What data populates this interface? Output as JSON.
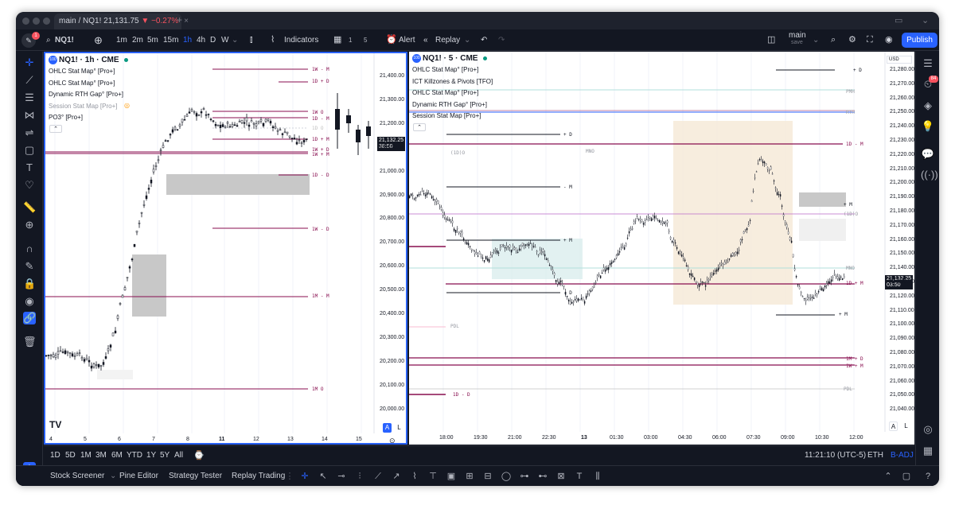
{
  "tab": {
    "title": "main / NQ1! 21,131.75",
    "change": "▼ −0.27%"
  },
  "toolbar": {
    "symbol": "NQ1!",
    "intervals": [
      "1m",
      "2m",
      "5m",
      "15m",
      "1h",
      "4h",
      "D",
      "W"
    ],
    "active_interval": "1h",
    "indicators": "Indicators",
    "badge1": "1",
    "badge5": "5",
    "alert": "Alert",
    "replay": "Replay",
    "layout_name": "main",
    "layout_status": "save",
    "publish": "Publish"
  },
  "left_pane": {
    "title": "NQ1! · 1h · CME",
    "indicators": [
      "OHLC Stat Map° [Pro+]",
      "OHLC Stat Map° [Pro+]",
      "Dynamic RTH Gap° [Pro+]",
      "Session Stat Map [Pro+]",
      "PO3° [Pro+]"
    ],
    "price_axis": [
      "21,400.00",
      "21,300.00",
      "21,200.00",
      "21,100.00",
      "21,000.00",
      "20,900.00",
      "20,800.00",
      "20,700.00",
      "20,600.00",
      "20,500.00",
      "20,400.00",
      "20,300.00",
      "20,200.00",
      "20,100.00",
      "20,000.00"
    ],
    "last_price": "21,132.25",
    "countdown": "38:50",
    "levels": [
      "1W - M",
      "1D + D",
      "1W O",
      "1D + M",
      "1D O",
      "1D - M",
      "1W + D",
      "1W + M",
      "1D - D",
      "1W - D",
      "1M - M",
      "1M O"
    ],
    "x_axis": [
      "4",
      "5",
      "6",
      "7",
      "8",
      "11",
      "12",
      "13",
      "14",
      "15"
    ],
    "logo": "TV",
    "scale_btn_a": "A",
    "scale_btn_l": "L"
  },
  "right_pane": {
    "title": "NQ1! · 5 · CME",
    "indicators": [
      "OHLC Stat Map° [Pro+]",
      "ICT Killzones & Pivots [TFO]",
      "OHLC Stat Map° [Pro+]",
      "Dynamic RTH Gap° [Pro+]",
      "Session Stat Map [Pro+]"
    ],
    "currency": "USD",
    "price_axis": [
      "21,280.00",
      "21,270.00",
      "21,260.00",
      "21,250.00",
      "21,240.00",
      "21,230.00",
      "21,220.00",
      "21,210.00",
      "21,200.00",
      "21,190.00",
      "21,180.00",
      "21,170.00",
      "21,160.00",
      "21,150.00",
      "21,140.00",
      "21,130.00",
      "21,120.00",
      "21,110.00",
      "21,100.00",
      "21,090.00",
      "21,080.00",
      "21,070.00",
      "21,060.00",
      "21,050.00",
      "21,040.00"
    ],
    "last_price": "21,132.25",
    "countdown": "03:50",
    "levels": [
      "+ D",
      "1D - M",
      "- M",
      "+ M",
      "- D",
      "1D + M",
      "+ M",
      "1M + D",
      "1W + M",
      "1D - D"
    ],
    "small_labels": [
      "PMH",
      "PML",
      "RTH",
      "MNO",
      "PDL",
      "MNO",
      "PDL",
      "(1D)O"
    ],
    "x_axis": [
      "18:00",
      "19:30",
      "21:00",
      "22:30",
      "13",
      "01:30",
      "03:00",
      "04:30",
      "06:00",
      "07:30",
      "09:00",
      "10:30",
      "12:00"
    ],
    "scale_btn_a": "A",
    "scale_btn_l": "L"
  },
  "bottom_bar": {
    "ranges": [
      "1D",
      "5D",
      "1M",
      "3M",
      "6M",
      "YTD",
      "1Y",
      "5Y",
      "All"
    ],
    "time": "11:21:10 (UTC-5)",
    "session": "ETH",
    "adj": "B-ADJ"
  },
  "footer": {
    "tabs": [
      "Stock Screener",
      "Pine Editor",
      "Strategy Tester",
      "Replay Trading"
    ]
  },
  "notifications": {
    "count": "1",
    "right_badge": "84"
  },
  "colors": {
    "accent": "#2962ff",
    "down": "#f7525f",
    "level": "#880e4f",
    "dark": "#131722"
  }
}
